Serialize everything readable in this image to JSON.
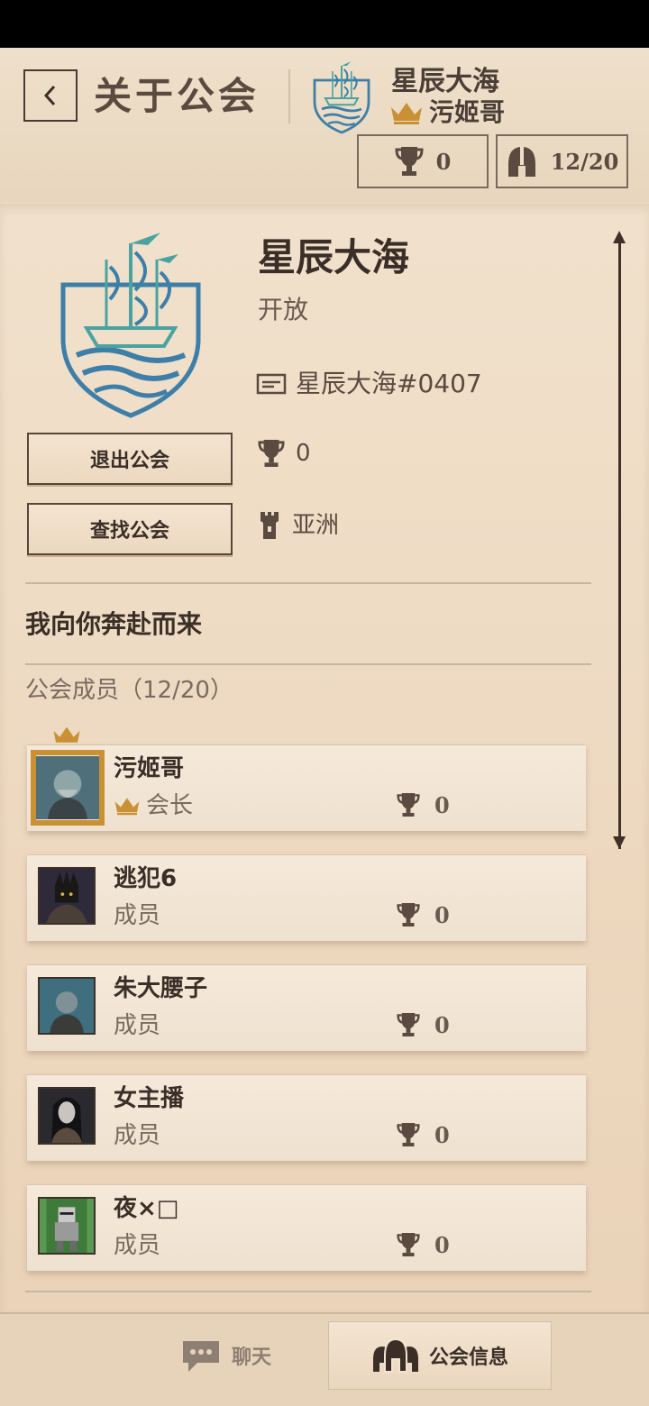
{
  "header": {
    "title": "关于公会",
    "guild_name": "星辰大海",
    "leader_name": "污姬哥",
    "trophies": "0",
    "members": "12/20"
  },
  "guild": {
    "name": "星辰大海",
    "status": "开放",
    "id": "星辰大海#0407",
    "trophies": "0",
    "region": "亚洲",
    "motto": "我向你奔赴而来",
    "members_title": "公会成员（12/20）"
  },
  "buttons": {
    "leave": "退出公会",
    "find": "查找公会"
  },
  "members": [
    {
      "name": "污姬哥",
      "role": "会长",
      "trophies": "0"
    },
    {
      "name": "逃犯6",
      "role": "成员",
      "trophies": "0"
    },
    {
      "name": "朱大腰子",
      "role": "成员",
      "trophies": "0"
    },
    {
      "name": "女主播",
      "role": "成员",
      "trophies": "0"
    },
    {
      "name": "夜×□",
      "role": "成员",
      "trophies": "0"
    }
  ],
  "tabs": {
    "chat": "聊天",
    "guild_info": "公会信息"
  },
  "colors": {
    "parchment": "#ecdcc6",
    "emblem_blue": "#3d7fa8",
    "emblem_teal": "#4aa3a0",
    "gold": "#c99134",
    "dark_brown": "#3a2e27"
  }
}
